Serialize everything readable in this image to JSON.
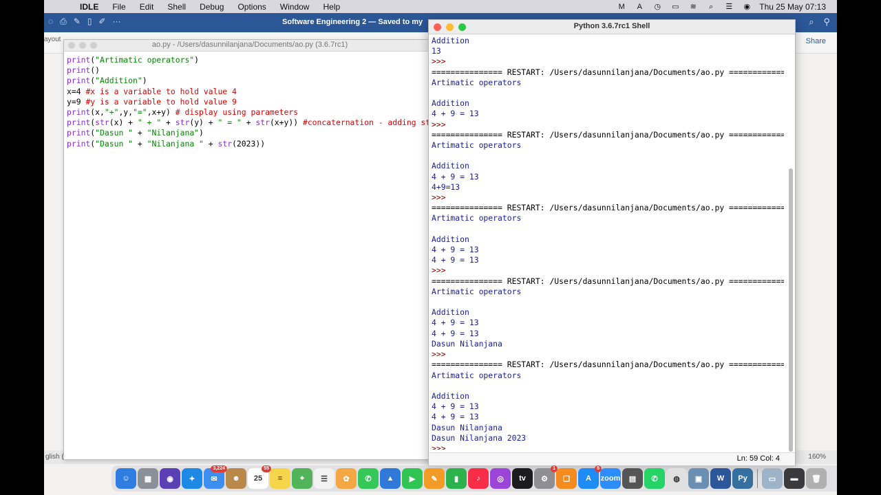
{
  "menubar": {
    "app_name": "IDLE",
    "items": [
      "File",
      "Edit",
      "Shell",
      "Debug",
      "Options",
      "Window",
      "Help"
    ],
    "clock": "Thu 25 May  07:13"
  },
  "word": {
    "title": "Software Engineering 2 — Saved to my",
    "share_label": "Share",
    "ribbon_fragment": "ayout",
    "language_fragment": "glish (",
    "zoom": "160%"
  },
  "editor": {
    "title": "ao.py - /Users/dasunnilanjana/Documents/ao.py (3.6.7rc1)",
    "line1": [
      "print",
      "(",
      "\"Artimatic operators\"",
      ")"
    ],
    "line2": [
      "print",
      "()"
    ],
    "line3": [
      "print",
      "(",
      "\"Addition\"",
      ")"
    ],
    "line4": [
      "x=4 ",
      "#x is a variable to hold value 4"
    ],
    "line5": [
      "y=9 ",
      "#y is a variable to hold value 9"
    ],
    "line6": [
      "print",
      "(x,",
      "\"+\"",
      ",y,",
      "\"=\"",
      ",x+y) ",
      "# display using parameters"
    ],
    "line7": [
      "print",
      "(",
      "str",
      "(x) + ",
      "\" + \"",
      " + ",
      "str",
      "(y) + ",
      "\" = \"",
      " + ",
      "str",
      "(x+y)) ",
      "#concaternation - adding strings"
    ],
    "line8": [
      "print",
      "(",
      "\"Dasun \"",
      " + ",
      "\"Nilanjana\"",
      ")"
    ],
    "line9": [
      "print",
      "(",
      "\"Dasun \"",
      " + ",
      "\"Nilanjana \"",
      " + ",
      "str",
      "(2023))"
    ]
  },
  "shell": {
    "title": "Python 3.6.7rc1 Shell",
    "status": "Ln: 59   Col: 4",
    "lines": [
      {
        "text": "Addition",
        "kind": "out"
      },
      {
        "text": "13",
        "kind": "out"
      },
      {
        "text": ">>> ",
        "kind": "prompt"
      },
      {
        "text": "=============== RESTART: /Users/dasunnilanjana/Documents/ao.py ===============",
        "kind": "restart"
      },
      {
        "text": "Artimatic operators",
        "kind": "out"
      },
      {
        "text": "",
        "kind": "out"
      },
      {
        "text": "Addition",
        "kind": "out"
      },
      {
        "text": "4 + 9 = 13",
        "kind": "out"
      },
      {
        "text": ">>> ",
        "kind": "prompt"
      },
      {
        "text": "=============== RESTART: /Users/dasunnilanjana/Documents/ao.py ===============",
        "kind": "restart"
      },
      {
        "text": "Artimatic operators",
        "kind": "out"
      },
      {
        "text": "",
        "kind": "out"
      },
      {
        "text": "Addition",
        "kind": "out"
      },
      {
        "text": "4 + 9 = 13",
        "kind": "out"
      },
      {
        "text": "4+9=13",
        "kind": "out"
      },
      {
        "text": ">>> ",
        "kind": "prompt"
      },
      {
        "text": "=============== RESTART: /Users/dasunnilanjana/Documents/ao.py ===============",
        "kind": "restart"
      },
      {
        "text": "Artimatic operators",
        "kind": "out"
      },
      {
        "text": "",
        "kind": "out"
      },
      {
        "text": "Addition",
        "kind": "out"
      },
      {
        "text": "4 + 9 = 13",
        "kind": "out"
      },
      {
        "text": "4 + 9 = 13",
        "kind": "out"
      },
      {
        "text": ">>> ",
        "kind": "prompt"
      },
      {
        "text": "=============== RESTART: /Users/dasunnilanjana/Documents/ao.py ===============",
        "kind": "restart"
      },
      {
        "text": "Artimatic operators",
        "kind": "out"
      },
      {
        "text": "",
        "kind": "out"
      },
      {
        "text": "Addition",
        "kind": "out"
      },
      {
        "text": "4 + 9 = 13",
        "kind": "out"
      },
      {
        "text": "4 + 9 = 13",
        "kind": "out"
      },
      {
        "text": "Dasun Nilanjana",
        "kind": "out"
      },
      {
        "text": ">>> ",
        "kind": "prompt"
      },
      {
        "text": "=============== RESTART: /Users/dasunnilanjana/Documents/ao.py ===============",
        "kind": "restart"
      },
      {
        "text": "Artimatic operators",
        "kind": "out"
      },
      {
        "text": "",
        "kind": "out"
      },
      {
        "text": "Addition",
        "kind": "out"
      },
      {
        "text": "4 + 9 = 13",
        "kind": "out"
      },
      {
        "text": "4 + 9 = 13",
        "kind": "out"
      },
      {
        "text": "Dasun Nilanjana",
        "kind": "out"
      },
      {
        "text": "Dasun Nilanjana 2023",
        "kind": "out"
      },
      {
        "text": ">>> ",
        "kind": "prompt"
      }
    ]
  },
  "dock": {
    "apps": [
      {
        "name": "finder-icon",
        "color": "#2f7de1",
        "glyph": "☺"
      },
      {
        "name": "launchpad-icon",
        "color": "#8a8f98",
        "glyph": "▦"
      },
      {
        "name": "siri-icon",
        "color": "#5a3fb5",
        "glyph": "◉"
      },
      {
        "name": "safari-icon",
        "color": "#1e88e5",
        "glyph": "✦"
      },
      {
        "name": "mail-icon",
        "color": "#3d8ef0",
        "glyph": "✉",
        "badge": "3,224"
      },
      {
        "name": "contacts-icon",
        "color": "#b8894a",
        "glyph": "☻"
      },
      {
        "name": "calendar-icon",
        "color": "#ffffff",
        "glyph": "25",
        "badge": "55"
      },
      {
        "name": "notes-icon",
        "color": "#f7d54b",
        "glyph": "≡"
      },
      {
        "name": "maps-icon",
        "color": "#52b45a",
        "glyph": "⌖"
      },
      {
        "name": "reminders-icon",
        "color": "#f2f2f2",
        "glyph": "☰"
      },
      {
        "name": "photos-icon",
        "color": "#f4a742",
        "glyph": "✿"
      },
      {
        "name": "messages-icon",
        "color": "#36c759",
        "glyph": "✆"
      },
      {
        "name": "keynote-icon",
        "color": "#2f79d9",
        "glyph": "▲"
      },
      {
        "name": "facetime-icon",
        "color": "#30c454",
        "glyph": "▶"
      },
      {
        "name": "pages-icon",
        "color": "#f39c25",
        "glyph": "✎"
      },
      {
        "name": "numbers-icon",
        "color": "#2bb24c",
        "glyph": "▮"
      },
      {
        "name": "music-icon",
        "color": "#fa2d48",
        "glyph": "♪"
      },
      {
        "name": "podcasts-icon",
        "color": "#9b45d8",
        "glyph": "◎"
      },
      {
        "name": "appletv-icon",
        "color": "#1c1c1e",
        "glyph": "tv"
      },
      {
        "name": "system-preferences-icon",
        "color": "#8e8e93",
        "glyph": "⚙",
        "badge": "1"
      },
      {
        "name": "books-icon",
        "color": "#f58b1f",
        "glyph": "❑"
      },
      {
        "name": "appstore-icon",
        "color": "#1d8cf6",
        "glyph": "A",
        "badge": "5"
      },
      {
        "name": "zoom-icon",
        "color": "#2d8cff",
        "glyph": "zoom"
      },
      {
        "name": "calculator-icon",
        "color": "#555555",
        "glyph": "▤"
      },
      {
        "name": "whatsapp-icon",
        "color": "#25d366",
        "glyph": "✆"
      },
      {
        "name": "chrome-icon",
        "color": "#e0e0e0",
        "glyph": "◍"
      },
      {
        "name": "preview-icon",
        "color": "#6b8fb3",
        "glyph": "▣"
      },
      {
        "name": "word-icon",
        "color": "#2b579a",
        "glyph": "W"
      },
      {
        "name": "python-icon",
        "color": "#3670a0",
        "glyph": "Py"
      }
    ],
    "right_apps": [
      {
        "name": "screenshot-icon",
        "color": "#9fb3c8",
        "glyph": "▭"
      },
      {
        "name": "downloads-icon",
        "color": "#3a3a3c",
        "glyph": "▬"
      },
      {
        "name": "trash-icon",
        "color": "#b0b0b0",
        "glyph": "🗑"
      }
    ]
  }
}
